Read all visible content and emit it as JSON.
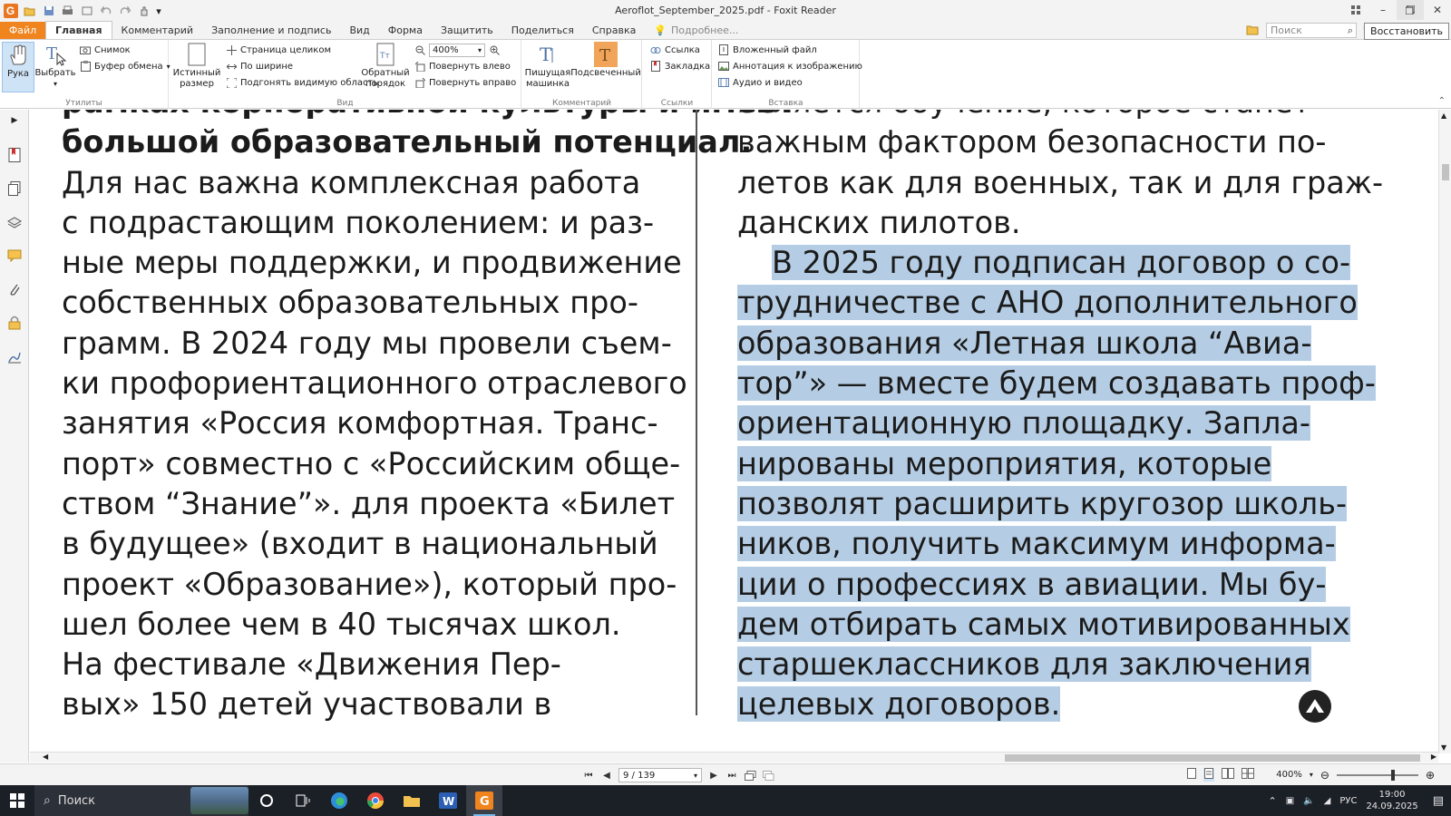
{
  "window": {
    "title": "Aeroflot_September_2025.pdf - Foxit Reader",
    "restore_tooltip": "Восстановить"
  },
  "menu": {
    "tabs": [
      "Файл",
      "Главная",
      "Комментарий",
      "Заполнение и подпись",
      "Вид",
      "Форма",
      "Защитить",
      "Поделиться",
      "Справка"
    ],
    "tell_me": "Подробнее...",
    "search_placeholder": "Поиск"
  },
  "ribbon": {
    "groups": {
      "utilities": "Утилиты",
      "view": "Вид",
      "comment": "Комментарий",
      "links": "Ссылки",
      "insert": "Вставка"
    },
    "hand": "Рука",
    "select": "Выбрать",
    "snapshot": "Снимок",
    "clipboard": "Буфер обмена",
    "actual_size_1": "Истинный",
    "actual_size_2": "размер",
    "fit_page": "Страница целиком",
    "fit_width": "По ширине",
    "fit_visible": "Подгонять видимую область",
    "reverse_1": "Обратный",
    "reverse_2": "порядок",
    "zoom_value": "400%",
    "rotate_left": "Повернуть влево",
    "rotate_right": "Повернуть вправо",
    "typewriter_1": "Пишущая",
    "typewriter_2": "машинка",
    "highlight": "Подсвеченный",
    "link": "Ссылка",
    "bookmark": "Закладка",
    "attached_file": "Вложенный файл",
    "image_annotation": "Аннотация к изображению",
    "audio_video": "Аудио и видео"
  },
  "document": {
    "left_lines": [
      {
        "text": "рамках корпоративной культуры и имеет",
        "bold": true
      },
      {
        "text": "большой образовательный потенциал.",
        "bold": true
      },
      {
        "text": "Для нас важна комплексная работа"
      },
      {
        "text": "с подрастающим поколением: и раз-"
      },
      {
        "text": "ные меры поддержки, и продвижение"
      },
      {
        "text": "собственных образовательных про-"
      },
      {
        "text": "грамм. В 2024 году мы провели съем-"
      },
      {
        "text": "ки профориентационного отраслевого"
      },
      {
        "text": "занятия «Россия комфортная. Транс-"
      },
      {
        "text": "порт» совместно с «Российским обще-"
      },
      {
        "text": "ством “Знание”». для проекта «Билет"
      },
      {
        "text": "в будущее» (входит в национальный"
      },
      {
        "text": "проект «Образование»), который про-"
      },
      {
        "text": "шел более чем в 40 тысячах школ."
      },
      {
        "text": "    На фестивале «Движения Пер-"
      },
      {
        "text": "вых» 150 детей участвовали в"
      }
    ],
    "right_lines": [
      {
        "text": "является обучение, которое станет",
        "hl": false
      },
      {
        "text": "важным фактором безопасности по-",
        "hl": false
      },
      {
        "text": "летов как для военных, так и для граж-",
        "hl": false
      },
      {
        "text": "данских пилотов.",
        "hl": false
      },
      {
        "text": "В 2025 году подписан договор о со-",
        "hl": true,
        "indent": true
      },
      {
        "text": "трудничестве с АНО дополнительного",
        "hl": true
      },
      {
        "text": "образования «Летная школа “Авиа-",
        "hl": true
      },
      {
        "text": "тор”» — вместе будем создавать проф-",
        "hl": true
      },
      {
        "text": "ориентационную площадку. Запла-",
        "hl": true
      },
      {
        "text": "нированы мероприятия, которые",
        "hl": true
      },
      {
        "text": "позволят расширить кругозор школь-",
        "hl": true
      },
      {
        "text": "ников, получить максимум информа-",
        "hl": true
      },
      {
        "text": "ции о профессиях в авиации. Мы бу-",
        "hl": true
      },
      {
        "text": "дем отбирать самых мотивированных",
        "hl": true
      },
      {
        "text": "старшеклассников для заключения",
        "hl": true
      },
      {
        "text": "целевых договоров.",
        "hl": true
      }
    ]
  },
  "statusbar": {
    "page_display": "9 / 139",
    "zoom": "400%"
  },
  "taskbar": {
    "search": "Поиск",
    "language": "РУС",
    "time": "19:00",
    "date": "24.09.2025"
  },
  "colors": {
    "accent": "#f0841f",
    "highlight": "#b5cde4",
    "taskbar": "#1b1f26"
  }
}
